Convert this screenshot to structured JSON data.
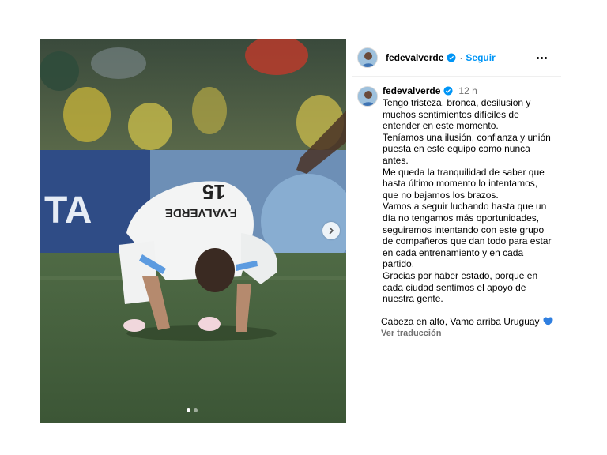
{
  "post": {
    "username": "fedevalverde",
    "follow_label": "Seguir",
    "separator": "·",
    "time": "12 h",
    "caption_lines": [
      "Tengo tristeza, bronca, desilusion y",
      "muchos sentimientos difíciles de",
      "entender en este momento.",
      "Teníamos una ilusión, confianza y unión",
      "puesta en este equipo como nunca",
      "antes.",
      "Me queda la tranquilidad de saber que",
      "hasta último momento lo intentamos,",
      "que no bajamos los brazos.",
      "Vamos a seguir luchando hasta que un",
      "día no tengamos más oportunidades,",
      "seguiremos intentando con este grupo",
      "de compañeros que dan todo para estar",
      "en cada entrenamiento y en cada",
      "partido.",
      "Gracias por haber estado, porque en",
      "cada ciudad sentimos el apoyo de",
      "nuestra gente."
    ],
    "signoff": "Cabeza en alto, Vamo arriba Uruguay",
    "signoff_emoji": "blue-heart-icon",
    "translate_label": "Ver traducción"
  },
  "photo": {
    "jersey_text": "F.VALVERDE",
    "jersey_number": "15",
    "ad_board_text": "TA",
    "carousel": {
      "total": 2,
      "active": 1
    }
  },
  "colors": {
    "link_blue": "#0095f6",
    "verified_blue": "#0095f6",
    "muted_text": "#737373",
    "heart_blue": "#2f7fe0"
  }
}
